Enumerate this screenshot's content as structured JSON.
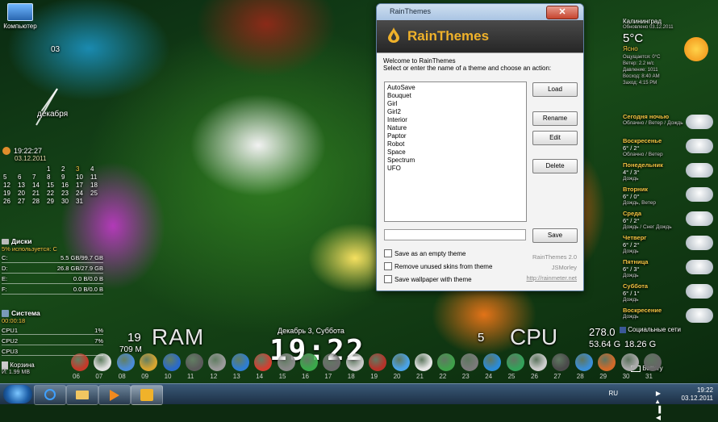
{
  "desktop": {
    "computer_icon_label": "Компьютер",
    "clock": {
      "number_12": "03",
      "month_label": "декабря"
    },
    "calendar": {
      "time": "19:22:27",
      "date": "03.12.2011",
      "days": [
        "",
        "",
        "",
        "1",
        "2",
        "3",
        "4",
        "5",
        "6",
        "7",
        "8",
        "9",
        "10",
        "11",
        "12",
        "13",
        "14",
        "15",
        "16",
        "17",
        "18",
        "19",
        "20",
        "21",
        "22",
        "23",
        "24",
        "25",
        "26",
        "27",
        "28",
        "29",
        "30",
        "31"
      ]
    },
    "disks": {
      "title": "Диски",
      "subtitle": "5% используется: C",
      "rows": [
        {
          "drive": "C:",
          "value": "5.5 GB/99.7 GB"
        },
        {
          "drive": "D:",
          "value": "26.8 GB/27.9 GB"
        },
        {
          "drive": "E:",
          "value": "0.0 B/0.0 B"
        },
        {
          "drive": "F:",
          "value": "0.0 B/0.0 B"
        }
      ]
    },
    "system": {
      "title": "Система",
      "uptime": "00:00:18",
      "rows": [
        {
          "label": "CPU1",
          "value": "1%"
        },
        {
          "label": "CPU2",
          "value": "7%"
        },
        {
          "label": "CPU3",
          "value": ""
        }
      ]
    },
    "bottom": {
      "ram_value": "19",
      "ram_mb": "709 M",
      "ram_label": "RAM",
      "date_line": "Декабрь 3, Суббота",
      "big_time": "19:22",
      "cpu_num": "5",
      "cpu_label": "CPU",
      "right_value_1": "278.0",
      "right_value_2": "53.64 G",
      "right_value_3": "18.26 G",
      "social_label": "Социальные сети",
      "battery_label": "Battery",
      "recycle_label": "Корзина",
      "recycle_sub": "И: 1.99 MB",
      "dock_numbers": [
        "06",
        "07",
        "08",
        "09",
        "10",
        "11",
        "12",
        "13",
        "14",
        "15",
        "16",
        "17",
        "18",
        "19",
        "20",
        "21",
        "22",
        "23",
        "24",
        "25",
        "26",
        "27",
        "28",
        "29",
        "30",
        "31"
      ]
    },
    "weather": {
      "city": "Калининград",
      "updated": "Обновлено 03.12.2011",
      "temp": "5°C",
      "condition": "Ясно",
      "details": [
        "Ощущается: 0°C",
        "Ветер: 2.2 м/с",
        "Давление: 1011",
        "Восход: 8:40 AM",
        "Заход: 4:15 PM"
      ],
      "forecast": [
        {
          "name": "Сегодня ночью",
          "temp": "",
          "desc": "Облачно / Ветер / Дождь"
        },
        {
          "name": "Воскресенье",
          "temp": "6° / 2°",
          "desc": "Облачно / Ветер"
        },
        {
          "name": "Понедельник",
          "temp": "4° / 3°",
          "desc": "Дождь"
        },
        {
          "name": "Вторник",
          "temp": "6° / 0°",
          "desc": "Дождь, Ветер"
        },
        {
          "name": "Среда",
          "temp": "6° / 2°",
          "desc": "Дождь / Снег Дождь"
        },
        {
          "name": "Четверг",
          "temp": "6° / 2°",
          "desc": "Дождь"
        },
        {
          "name": "Пятница",
          "temp": "6° / 3°",
          "desc": "Дождь"
        },
        {
          "name": "Суббота",
          "temp": "6° / 1°",
          "desc": "Дождь"
        },
        {
          "name": "Воскресение",
          "temp": "",
          "desc": "Дождь"
        }
      ]
    }
  },
  "dialog": {
    "window_title": "RainThemes",
    "close_symbol": "✕",
    "brand": "RainThemes",
    "welcome": "Welcome to RainThemes",
    "instruction": "Select or enter the name of a theme and choose an action:",
    "themes": [
      "AutoSave",
      "Bouquet",
      "Girl",
      "Girl2",
      "Interior",
      "Nature",
      "Paptor",
      "Robot",
      "Space",
      "Spectrum",
      "UFO"
    ],
    "buttons": {
      "load": "Load",
      "rename": "Rename",
      "edit": "Edit",
      "delete": "Delete",
      "save": "Save"
    },
    "name_input_value": "",
    "checkboxes": [
      "Save as an empty theme",
      "Remove unused skins from theme",
      "Save wallpaper with theme"
    ],
    "version": "RainThemes 2.0",
    "author": "JSMorley",
    "link": "http://rainmeter.net"
  },
  "taskbar": {
    "language": "RU",
    "time": "19:22",
    "date": "03.12.2011"
  }
}
